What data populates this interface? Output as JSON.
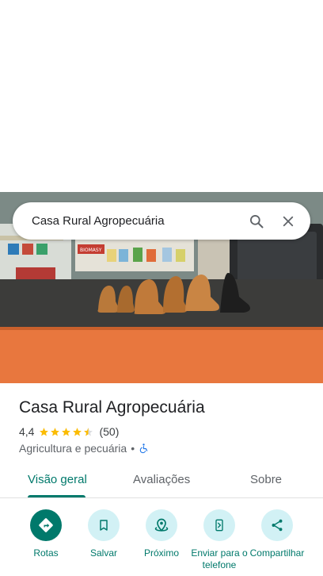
{
  "search": {
    "query": "Casa Rural Agropecuária"
  },
  "place": {
    "name": "Casa Rural Agropecuária",
    "rating": "4,4",
    "rating_value": 4.4,
    "review_count": "(50)",
    "category": "Agricultura e pecuária",
    "separator": "•"
  },
  "photo": {
    "sign_text": "BIOMASY"
  },
  "tabs": [
    {
      "label": "Visão geral",
      "active": true
    },
    {
      "label": "Avaliações",
      "active": false
    },
    {
      "label": "Sobre",
      "active": false
    }
  ],
  "actions": [
    {
      "label": "Rotas",
      "icon": "directions-icon"
    },
    {
      "label": "Salvar",
      "icon": "bookmark-icon"
    },
    {
      "label": "Próximo",
      "icon": "nearby-icon"
    },
    {
      "label": "Enviar para o telefone",
      "icon": "send-to-phone-icon"
    },
    {
      "label": "Compartilhar",
      "icon": "share-icon"
    }
  ],
  "colors": {
    "accent": "#00796b",
    "action_bg": "#d2f1f5",
    "star": "#fbbc04",
    "accessibility": "#1a73e8"
  }
}
